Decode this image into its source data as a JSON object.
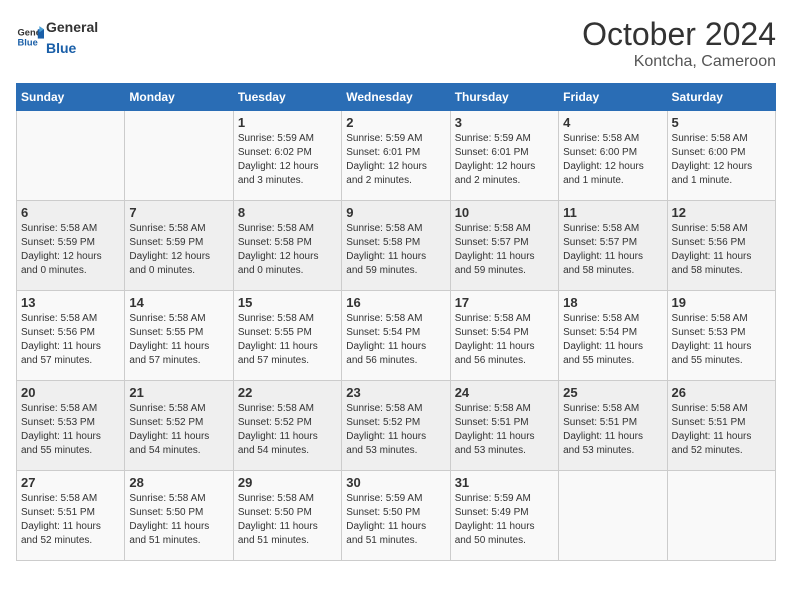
{
  "header": {
    "logo_general": "General",
    "logo_blue": "Blue",
    "month_year": "October 2024",
    "location": "Kontcha, Cameroon"
  },
  "weekdays": [
    "Sunday",
    "Monday",
    "Tuesday",
    "Wednesday",
    "Thursday",
    "Friday",
    "Saturday"
  ],
  "weeks": [
    [
      {
        "day": "",
        "info": ""
      },
      {
        "day": "",
        "info": ""
      },
      {
        "day": "1",
        "info": "Sunrise: 5:59 AM\nSunset: 6:02 PM\nDaylight: 12 hours\nand 3 minutes."
      },
      {
        "day": "2",
        "info": "Sunrise: 5:59 AM\nSunset: 6:01 PM\nDaylight: 12 hours\nand 2 minutes."
      },
      {
        "day": "3",
        "info": "Sunrise: 5:59 AM\nSunset: 6:01 PM\nDaylight: 12 hours\nand 2 minutes."
      },
      {
        "day": "4",
        "info": "Sunrise: 5:58 AM\nSunset: 6:00 PM\nDaylight: 12 hours\nand 1 minute."
      },
      {
        "day": "5",
        "info": "Sunrise: 5:58 AM\nSunset: 6:00 PM\nDaylight: 12 hours\nand 1 minute."
      }
    ],
    [
      {
        "day": "6",
        "info": "Sunrise: 5:58 AM\nSunset: 5:59 PM\nDaylight: 12 hours\nand 0 minutes."
      },
      {
        "day": "7",
        "info": "Sunrise: 5:58 AM\nSunset: 5:59 PM\nDaylight: 12 hours\nand 0 minutes."
      },
      {
        "day": "8",
        "info": "Sunrise: 5:58 AM\nSunset: 5:58 PM\nDaylight: 12 hours\nand 0 minutes."
      },
      {
        "day": "9",
        "info": "Sunrise: 5:58 AM\nSunset: 5:58 PM\nDaylight: 11 hours\nand 59 minutes."
      },
      {
        "day": "10",
        "info": "Sunrise: 5:58 AM\nSunset: 5:57 PM\nDaylight: 11 hours\nand 59 minutes."
      },
      {
        "day": "11",
        "info": "Sunrise: 5:58 AM\nSunset: 5:57 PM\nDaylight: 11 hours\nand 58 minutes."
      },
      {
        "day": "12",
        "info": "Sunrise: 5:58 AM\nSunset: 5:56 PM\nDaylight: 11 hours\nand 58 minutes."
      }
    ],
    [
      {
        "day": "13",
        "info": "Sunrise: 5:58 AM\nSunset: 5:56 PM\nDaylight: 11 hours\nand 57 minutes."
      },
      {
        "day": "14",
        "info": "Sunrise: 5:58 AM\nSunset: 5:55 PM\nDaylight: 11 hours\nand 57 minutes."
      },
      {
        "day": "15",
        "info": "Sunrise: 5:58 AM\nSunset: 5:55 PM\nDaylight: 11 hours\nand 57 minutes."
      },
      {
        "day": "16",
        "info": "Sunrise: 5:58 AM\nSunset: 5:54 PM\nDaylight: 11 hours\nand 56 minutes."
      },
      {
        "day": "17",
        "info": "Sunrise: 5:58 AM\nSunset: 5:54 PM\nDaylight: 11 hours\nand 56 minutes."
      },
      {
        "day": "18",
        "info": "Sunrise: 5:58 AM\nSunset: 5:54 PM\nDaylight: 11 hours\nand 55 minutes."
      },
      {
        "day": "19",
        "info": "Sunrise: 5:58 AM\nSunset: 5:53 PM\nDaylight: 11 hours\nand 55 minutes."
      }
    ],
    [
      {
        "day": "20",
        "info": "Sunrise: 5:58 AM\nSunset: 5:53 PM\nDaylight: 11 hours\nand 55 minutes."
      },
      {
        "day": "21",
        "info": "Sunrise: 5:58 AM\nSunset: 5:52 PM\nDaylight: 11 hours\nand 54 minutes."
      },
      {
        "day": "22",
        "info": "Sunrise: 5:58 AM\nSunset: 5:52 PM\nDaylight: 11 hours\nand 54 minutes."
      },
      {
        "day": "23",
        "info": "Sunrise: 5:58 AM\nSunset: 5:52 PM\nDaylight: 11 hours\nand 53 minutes."
      },
      {
        "day": "24",
        "info": "Sunrise: 5:58 AM\nSunset: 5:51 PM\nDaylight: 11 hours\nand 53 minutes."
      },
      {
        "day": "25",
        "info": "Sunrise: 5:58 AM\nSunset: 5:51 PM\nDaylight: 11 hours\nand 53 minutes."
      },
      {
        "day": "26",
        "info": "Sunrise: 5:58 AM\nSunset: 5:51 PM\nDaylight: 11 hours\nand 52 minutes."
      }
    ],
    [
      {
        "day": "27",
        "info": "Sunrise: 5:58 AM\nSunset: 5:51 PM\nDaylight: 11 hours\nand 52 minutes."
      },
      {
        "day": "28",
        "info": "Sunrise: 5:58 AM\nSunset: 5:50 PM\nDaylight: 11 hours\nand 51 minutes."
      },
      {
        "day": "29",
        "info": "Sunrise: 5:58 AM\nSunset: 5:50 PM\nDaylight: 11 hours\nand 51 minutes."
      },
      {
        "day": "30",
        "info": "Sunrise: 5:59 AM\nSunset: 5:50 PM\nDaylight: 11 hours\nand 51 minutes."
      },
      {
        "day": "31",
        "info": "Sunrise: 5:59 AM\nSunset: 5:49 PM\nDaylight: 11 hours\nand 50 minutes."
      },
      {
        "day": "",
        "info": ""
      },
      {
        "day": "",
        "info": ""
      }
    ]
  ]
}
